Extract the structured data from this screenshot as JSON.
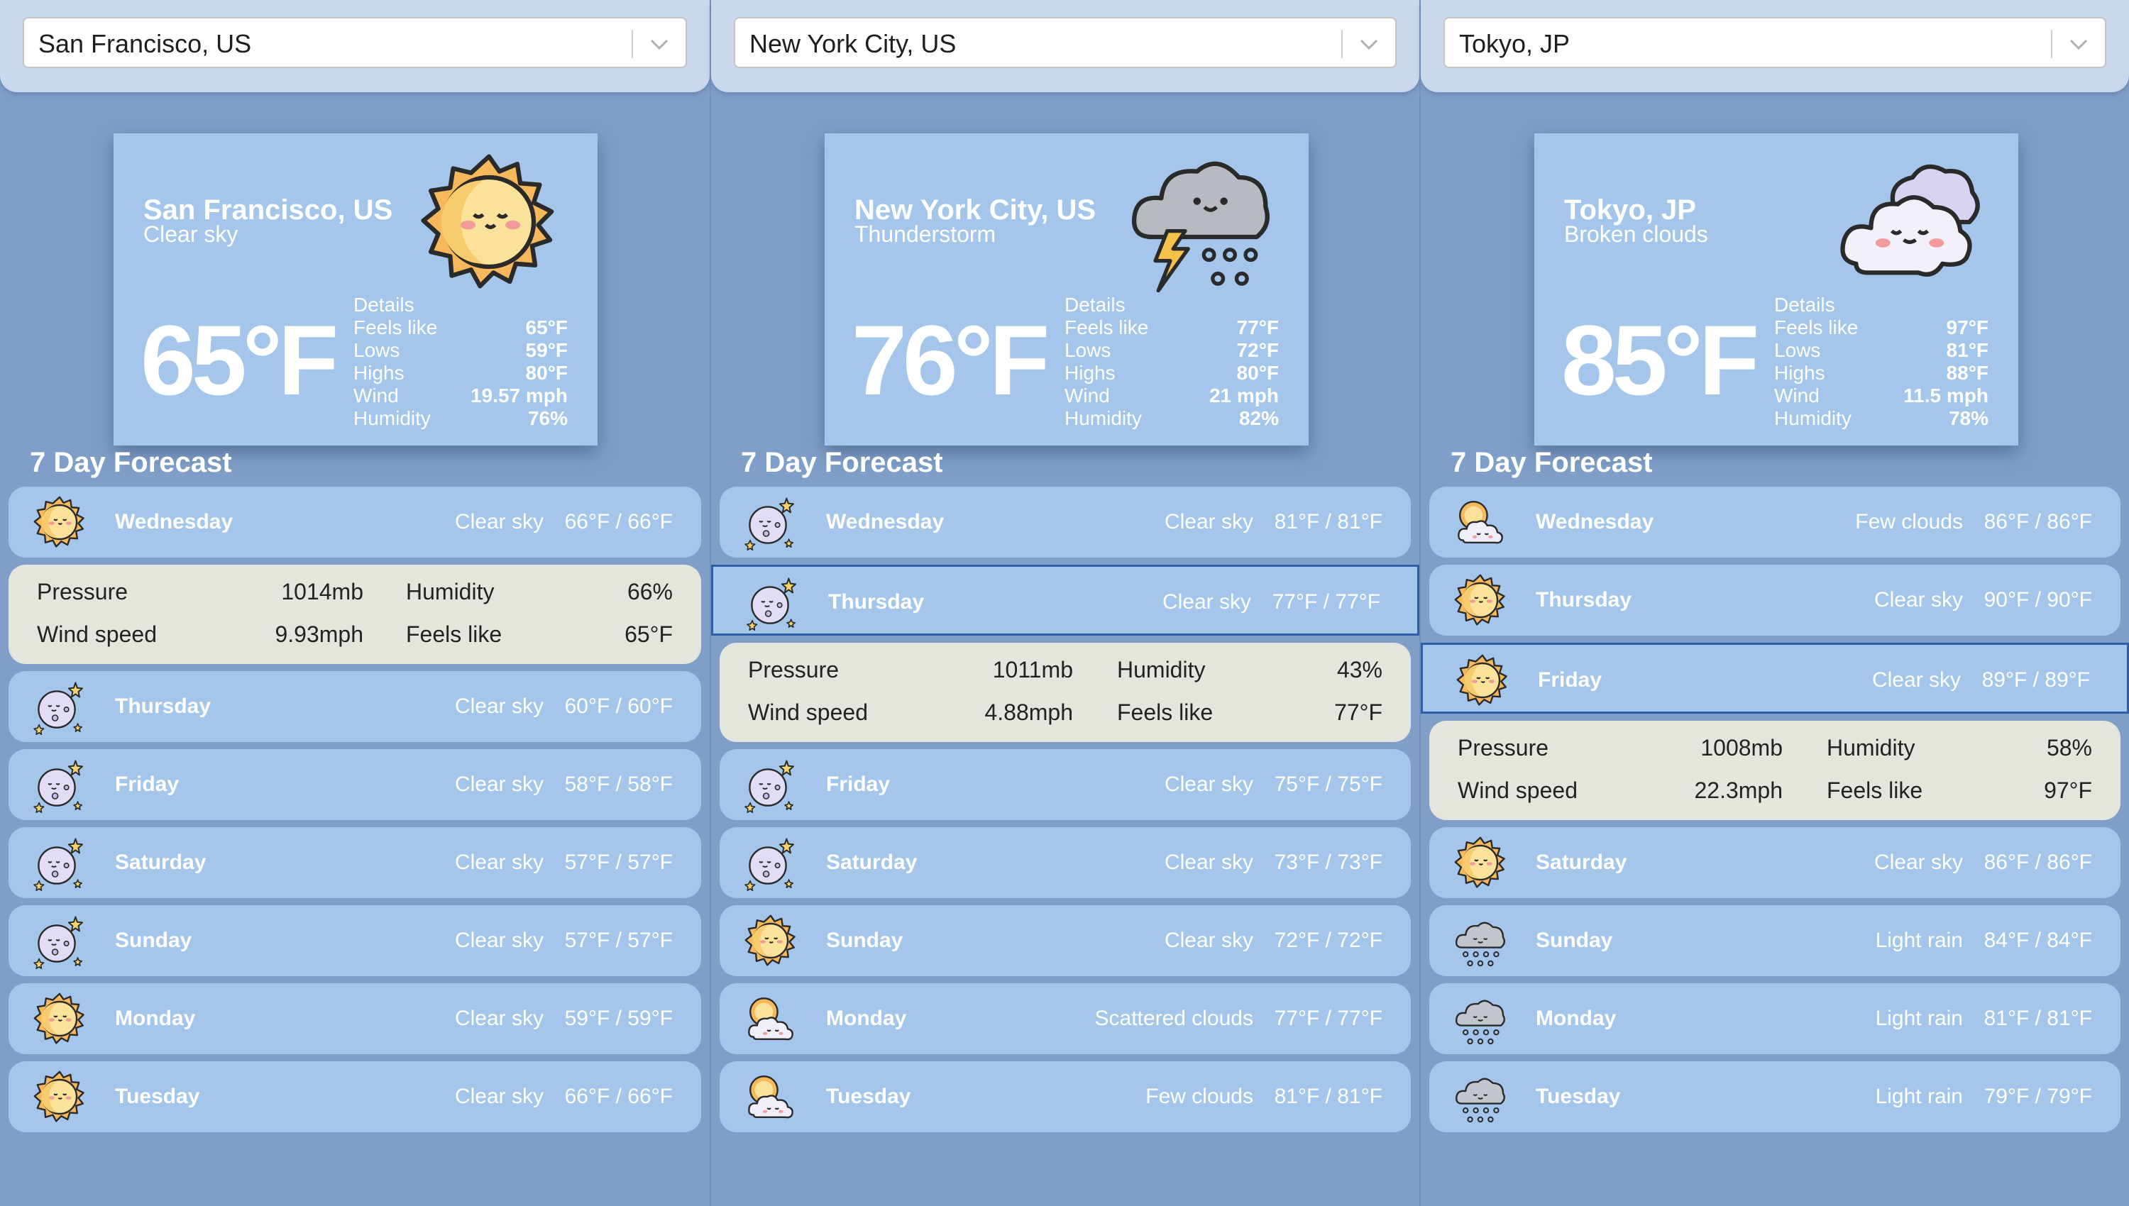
{
  "colors": {
    "background": "#7f9fc8",
    "card": "#a4c6ea",
    "detail_box": "#e4e6dd",
    "selected_border": "#2e5fa8"
  },
  "panels": [
    {
      "select_value": "San Francisco, US",
      "city": "San Francisco, US",
      "condition": "Clear sky",
      "condition_icon": "sun-icon",
      "temperature": "65°F",
      "details_title": "Details",
      "details": [
        {
          "label": "Feels like",
          "value": "65°F"
        },
        {
          "label": "Lows",
          "value": "59°F"
        },
        {
          "label": "Highs",
          "value": "80°F"
        },
        {
          "label": "Wind",
          "value": "19.57 mph"
        },
        {
          "label": "Humidity",
          "value": "76%"
        }
      ],
      "forecast_title": "7 Day Forecast",
      "days": [
        {
          "name": "Wednesday",
          "condition": "Clear sky",
          "temps": "66°F / 66°F",
          "icon": "sun-icon"
        },
        {
          "name": "Thursday",
          "condition": "Clear sky",
          "temps": "60°F / 60°F",
          "icon": "moon-icon"
        },
        {
          "name": "Friday",
          "condition": "Clear sky",
          "temps": "58°F / 58°F",
          "icon": "moon-icon"
        },
        {
          "name": "Saturday",
          "condition": "Clear sky",
          "temps": "57°F / 57°F",
          "icon": "moon-icon"
        },
        {
          "name": "Sunday",
          "condition": "Clear sky",
          "temps": "57°F / 57°F",
          "icon": "moon-icon"
        },
        {
          "name": "Monday",
          "condition": "Clear sky",
          "temps": "59°F / 59°F",
          "icon": "sun-icon"
        },
        {
          "name": "Tuesday",
          "condition": "Clear sky",
          "temps": "66°F / 66°F",
          "icon": "sun-icon"
        }
      ],
      "expanded_after": 0,
      "selected_day": null,
      "expanded": {
        "pressure_label": "Pressure",
        "pressure": "1014mb",
        "humidity_label": "Humidity",
        "humidity": "66%",
        "wind_label": "Wind speed",
        "wind": "9.93mph",
        "feels_label": "Feels like",
        "feels": "65°F"
      }
    },
    {
      "select_value": "New York City, US",
      "city": "New York City, US",
      "condition": "Thunderstorm",
      "condition_icon": "thunderstorm-icon",
      "temperature": "76°F",
      "details_title": "Details",
      "details": [
        {
          "label": "Feels like",
          "value": "77°F"
        },
        {
          "label": "Lows",
          "value": "72°F"
        },
        {
          "label": "Highs",
          "value": "80°F"
        },
        {
          "label": "Wind",
          "value": "21 mph"
        },
        {
          "label": "Humidity",
          "value": "82%"
        }
      ],
      "forecast_title": "7 Day Forecast",
      "days": [
        {
          "name": "Wednesday",
          "condition": "Clear sky",
          "temps": "81°F / 81°F",
          "icon": "moon-icon"
        },
        {
          "name": "Thursday",
          "condition": "Clear sky",
          "temps": "77°F / 77°F",
          "icon": "moon-icon"
        },
        {
          "name": "Friday",
          "condition": "Clear sky",
          "temps": "75°F / 75°F",
          "icon": "moon-icon"
        },
        {
          "name": "Saturday",
          "condition": "Clear sky",
          "temps": "73°F / 73°F",
          "icon": "moon-icon"
        },
        {
          "name": "Sunday",
          "condition": "Clear sky",
          "temps": "72°F / 72°F",
          "icon": "sun-icon"
        },
        {
          "name": "Monday",
          "condition": "Scattered clouds",
          "temps": "77°F / 77°F",
          "icon": "sun-cloud-icon"
        },
        {
          "name": "Tuesday",
          "condition": "Few clouds",
          "temps": "81°F / 81°F",
          "icon": "sun-cloud-icon"
        }
      ],
      "expanded_after": 1,
      "selected_day": 1,
      "expanded": {
        "pressure_label": "Pressure",
        "pressure": "1011mb",
        "humidity_label": "Humidity",
        "humidity": "43%",
        "wind_label": "Wind speed",
        "wind": "4.88mph",
        "feels_label": "Feels like",
        "feels": "77°F"
      }
    },
    {
      "select_value": "Tokyo, JP",
      "city": "Tokyo, JP",
      "condition": "Broken clouds",
      "condition_icon": "clouds-icon",
      "temperature": "85°F",
      "details_title": "Details",
      "details": [
        {
          "label": "Feels like",
          "value": "97°F"
        },
        {
          "label": "Lows",
          "value": "81°F"
        },
        {
          "label": "Highs",
          "value": "88°F"
        },
        {
          "label": "Wind",
          "value": "11.5 mph"
        },
        {
          "label": "Humidity",
          "value": "78%"
        }
      ],
      "forecast_title": "7 Day Forecast",
      "days": [
        {
          "name": "Wednesday",
          "condition": "Few clouds",
          "temps": "86°F / 86°F",
          "icon": "sun-cloud-icon"
        },
        {
          "name": "Thursday",
          "condition": "Clear sky",
          "temps": "90°F / 90°F",
          "icon": "sun-icon"
        },
        {
          "name": "Friday",
          "condition": "Clear sky",
          "temps": "89°F / 89°F",
          "icon": "sun-icon"
        },
        {
          "name": "Saturday",
          "condition": "Clear sky",
          "temps": "86°F / 86°F",
          "icon": "sun-icon"
        },
        {
          "name": "Sunday",
          "condition": "Light rain",
          "temps": "84°F / 84°F",
          "icon": "rain-icon"
        },
        {
          "name": "Monday",
          "condition": "Light rain",
          "temps": "81°F / 81°F",
          "icon": "rain-icon"
        },
        {
          "name": "Tuesday",
          "condition": "Light rain",
          "temps": "79°F / 79°F",
          "icon": "rain-icon"
        }
      ],
      "expanded_after": 2,
      "selected_day": 2,
      "expanded": {
        "pressure_label": "Pressure",
        "pressure": "1008mb",
        "humidity_label": "Humidity",
        "humidity": "58%",
        "wind_label": "Wind speed",
        "wind": "22.3mph",
        "feels_label": "Feels like",
        "feels": "97°F"
      }
    }
  ]
}
